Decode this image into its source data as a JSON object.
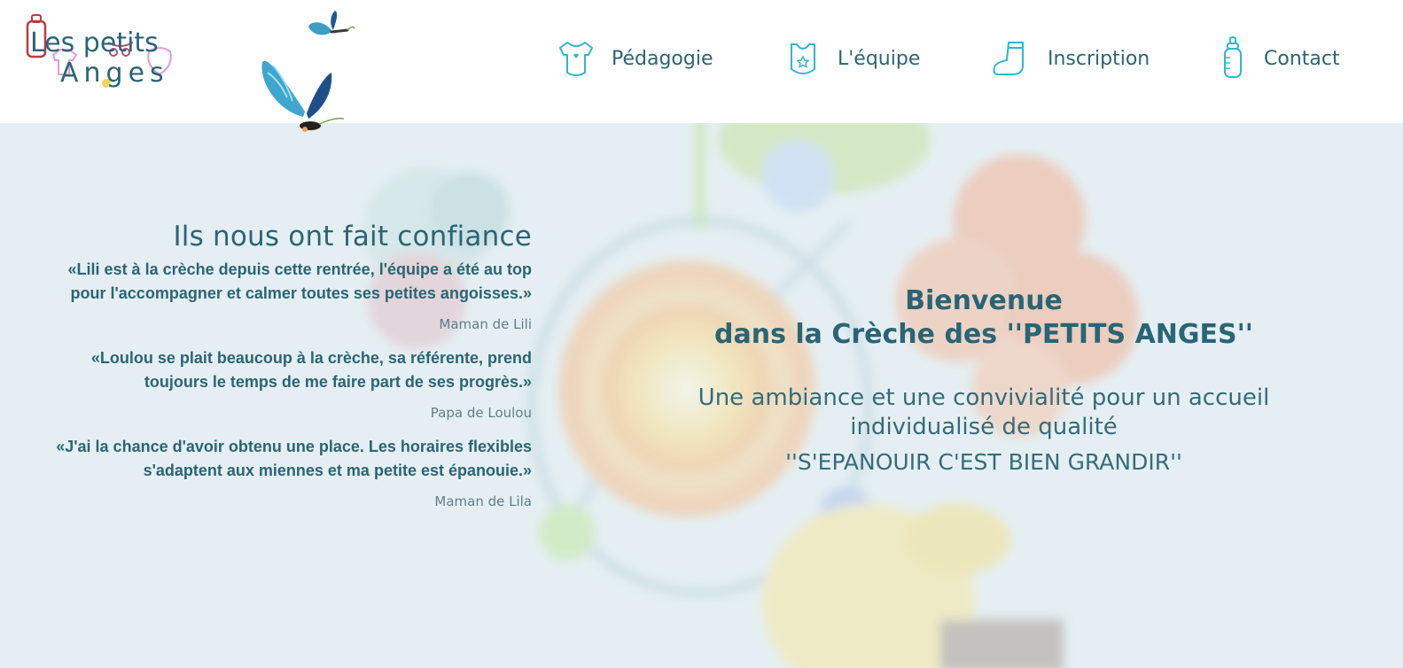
{
  "brand": {
    "logo_line1": "Les petits",
    "logo_line2": "Anges",
    "colors": {
      "primary_text": "#2a6575",
      "icon_cyan": "#2fb6cf",
      "logo_red": "#c0393e",
      "logo_pink": "#e29ad4"
    }
  },
  "nav": {
    "items": [
      {
        "label": "Pédagogie",
        "icon": "baby-bodysuit-icon"
      },
      {
        "label": "L'équipe",
        "icon": "bib-icon"
      },
      {
        "label": "Inscription",
        "icon": "sock-icon"
      },
      {
        "label": "Contact",
        "icon": "baby-bottle-icon"
      }
    ]
  },
  "testimonials": {
    "title": "Ils nous ont fait confiance",
    "items": [
      {
        "quote": "«Lili est à la crèche depuis cette rentrée, l'équipe a été au top pour l'accompagner et calmer toutes ses petites angoisses.»",
        "author": "Maman de Lili"
      },
      {
        "quote": "«Loulou se plait beaucoup à la crèche, sa référente, prend toujours le temps de me faire part de ses progrès.»",
        "author": "Papa de Loulou"
      },
      {
        "quote": "«J'ai la chance d'avoir obtenu une place. Les horaires flexibles s'adaptent aux miennes et ma petite est épanouie.»",
        "author": "Maman de Lila"
      }
    ]
  },
  "welcome": {
    "title_line1": "Bienvenue",
    "title_line2": "dans la Crèche des ''PETITS ANGES''",
    "subtitle": "Une ambiance et une convivialité pour un accueil individualisé de qualité",
    "motto": "''S'EPANOUIR C'EST BIEN GRANDIR''"
  }
}
